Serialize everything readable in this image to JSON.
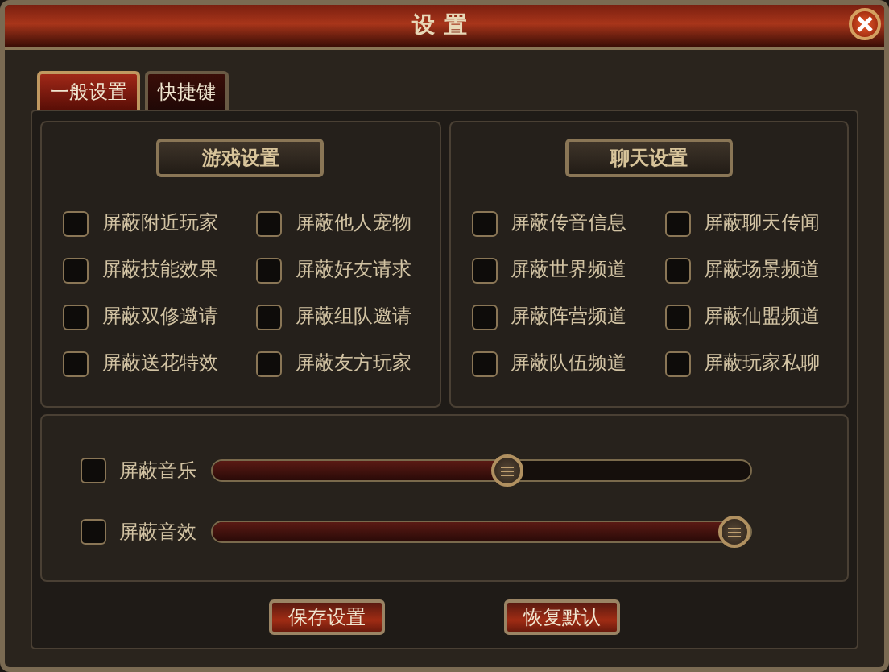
{
  "window": {
    "title": "设置"
  },
  "tabs": [
    {
      "label": "一般设置",
      "selected": true
    },
    {
      "label": "快捷键",
      "selected": false
    }
  ],
  "groups": [
    {
      "title": "游戏设置",
      "options": [
        {
          "label": "屏蔽附近玩家",
          "checked": false
        },
        {
          "label": "屏蔽他人宠物",
          "checked": false
        },
        {
          "label": "屏蔽技能效果",
          "checked": false
        },
        {
          "label": "屏蔽好友请求",
          "checked": false
        },
        {
          "label": "屏蔽双修邀请",
          "checked": false
        },
        {
          "label": "屏蔽组队邀请",
          "checked": false
        },
        {
          "label": "屏蔽送花特效",
          "checked": false
        },
        {
          "label": "屏蔽友方玩家",
          "checked": false
        }
      ]
    },
    {
      "title": "聊天设置",
      "options": [
        {
          "label": "屏蔽传音信息",
          "checked": false
        },
        {
          "label": "屏蔽聊天传闻",
          "checked": false
        },
        {
          "label": "屏蔽世界频道",
          "checked": false
        },
        {
          "label": "屏蔽场景频道",
          "checked": false
        },
        {
          "label": "屏蔽阵营频道",
          "checked": false
        },
        {
          "label": "屏蔽仙盟频道",
          "checked": false
        },
        {
          "label": "屏蔽队伍频道",
          "checked": false
        },
        {
          "label": "屏蔽玩家私聊",
          "checked": false
        }
      ]
    }
  ],
  "sound": [
    {
      "label": "屏蔽音乐",
      "checked": false,
      "level": 0.55
    },
    {
      "label": "屏蔽音效",
      "checked": false,
      "level": 1
    }
  ],
  "buttons": [
    "保存设置",
    "恢复默认"
  ]
}
